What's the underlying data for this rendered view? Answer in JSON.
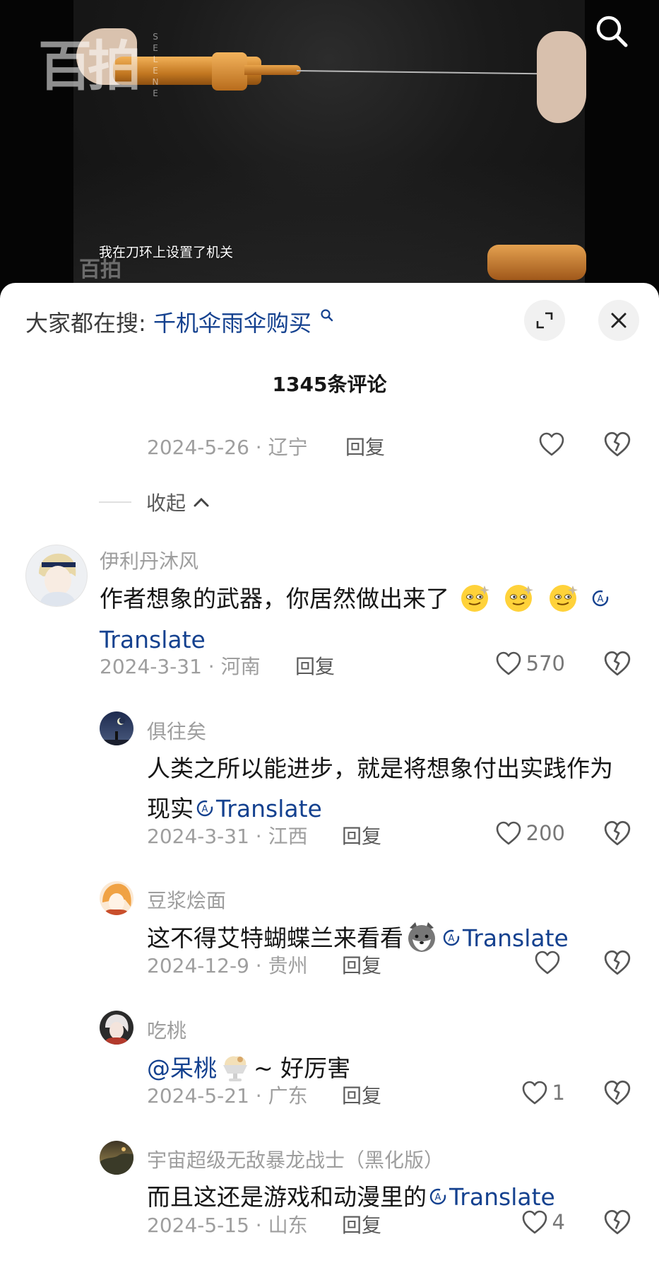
{
  "video": {
    "subtitle": "我在刀环上设置了机关",
    "logo_text": "百拍",
    "logo_side_text": "SELENE"
  },
  "hot_search": {
    "prefix": "大家都在搜:",
    "query": "千机伞雨伞购买"
  },
  "comments_header": {
    "title": "1345条评论"
  },
  "previous_meta": {
    "date_loc": "2024-5-26 · 辽宁",
    "reply": "回复"
  },
  "collapse_label": "收起",
  "comments": [
    {
      "user": "伊利丹沐风",
      "text": "作者想象的武器，你居然做出来了",
      "translate": "Translate",
      "date_loc": "2024-3-31 · 河南",
      "reply": "回复",
      "likes": "570"
    },
    {
      "user": "俱往矣",
      "text": "人类之所以能进步，就是将想象付出实践作为现实",
      "translate": "Translate",
      "date_loc": "2024-3-31 · 江西",
      "reply": "回复",
      "likes": "200"
    },
    {
      "user": "豆浆烩面",
      "text": "这不得艾特蝴蝶兰来看看",
      "translate": "Translate",
      "date_loc": "2024-12-9 · 贵州",
      "reply": "回复",
      "likes": ""
    },
    {
      "user": "吃桃",
      "mention": "@呆桃",
      "text_after": "~ 好厉害",
      "date_loc": "2024-5-21 · 广东",
      "reply": "回复",
      "likes": "1"
    },
    {
      "user": "宇宙超级无敌暴龙战士（黑化版）",
      "text": "而且这还是游戏和动漫里的",
      "translate": "Translate",
      "date_loc": "2024-5-15 · 山东",
      "reply": "回复",
      "likes": "4"
    }
  ],
  "colors": {
    "link": "#14418f",
    "meta": "#9e9e9e",
    "text": "#161616"
  }
}
